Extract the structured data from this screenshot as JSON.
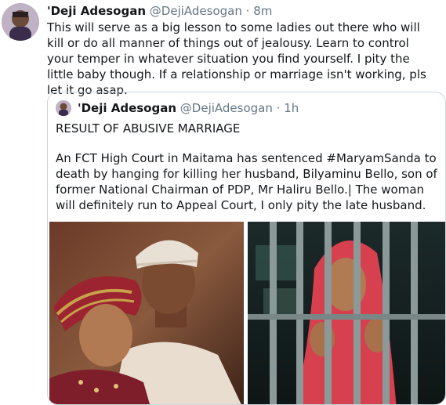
{
  "tweet": {
    "display_name": "'Deji Adesogan",
    "handle": "@DejiAdesogan",
    "separator": "·",
    "time": "8m",
    "text": "This will serve as a big lesson to some ladies out there who will kill or do all manner of things out of jealousy. Learn to control your temper in whatever situation you find yourself. I pity the little baby though. If a relationship or marriage isn't working, pls let it go asap."
  },
  "quote": {
    "display_name": "'Deji Adesogan",
    "handle": "@DejiAdesogan",
    "separator": "·",
    "time": "1h",
    "line1": "RESULT OF ABUSIVE MARRIAGE",
    "paragraph": "An FCT High Court in Maitama has sentenced #MaryamSanda to death by hanging for killing her husband, Bilyaminu Bello, son of former National Chairman of PDP, Mr Haliru Bello.| The woman will definitely run to Appeal Court, I only pity the late husband."
  },
  "colors": {
    "text": "#14171a",
    "secondary": "#657786",
    "border": "#ccd6dd"
  }
}
